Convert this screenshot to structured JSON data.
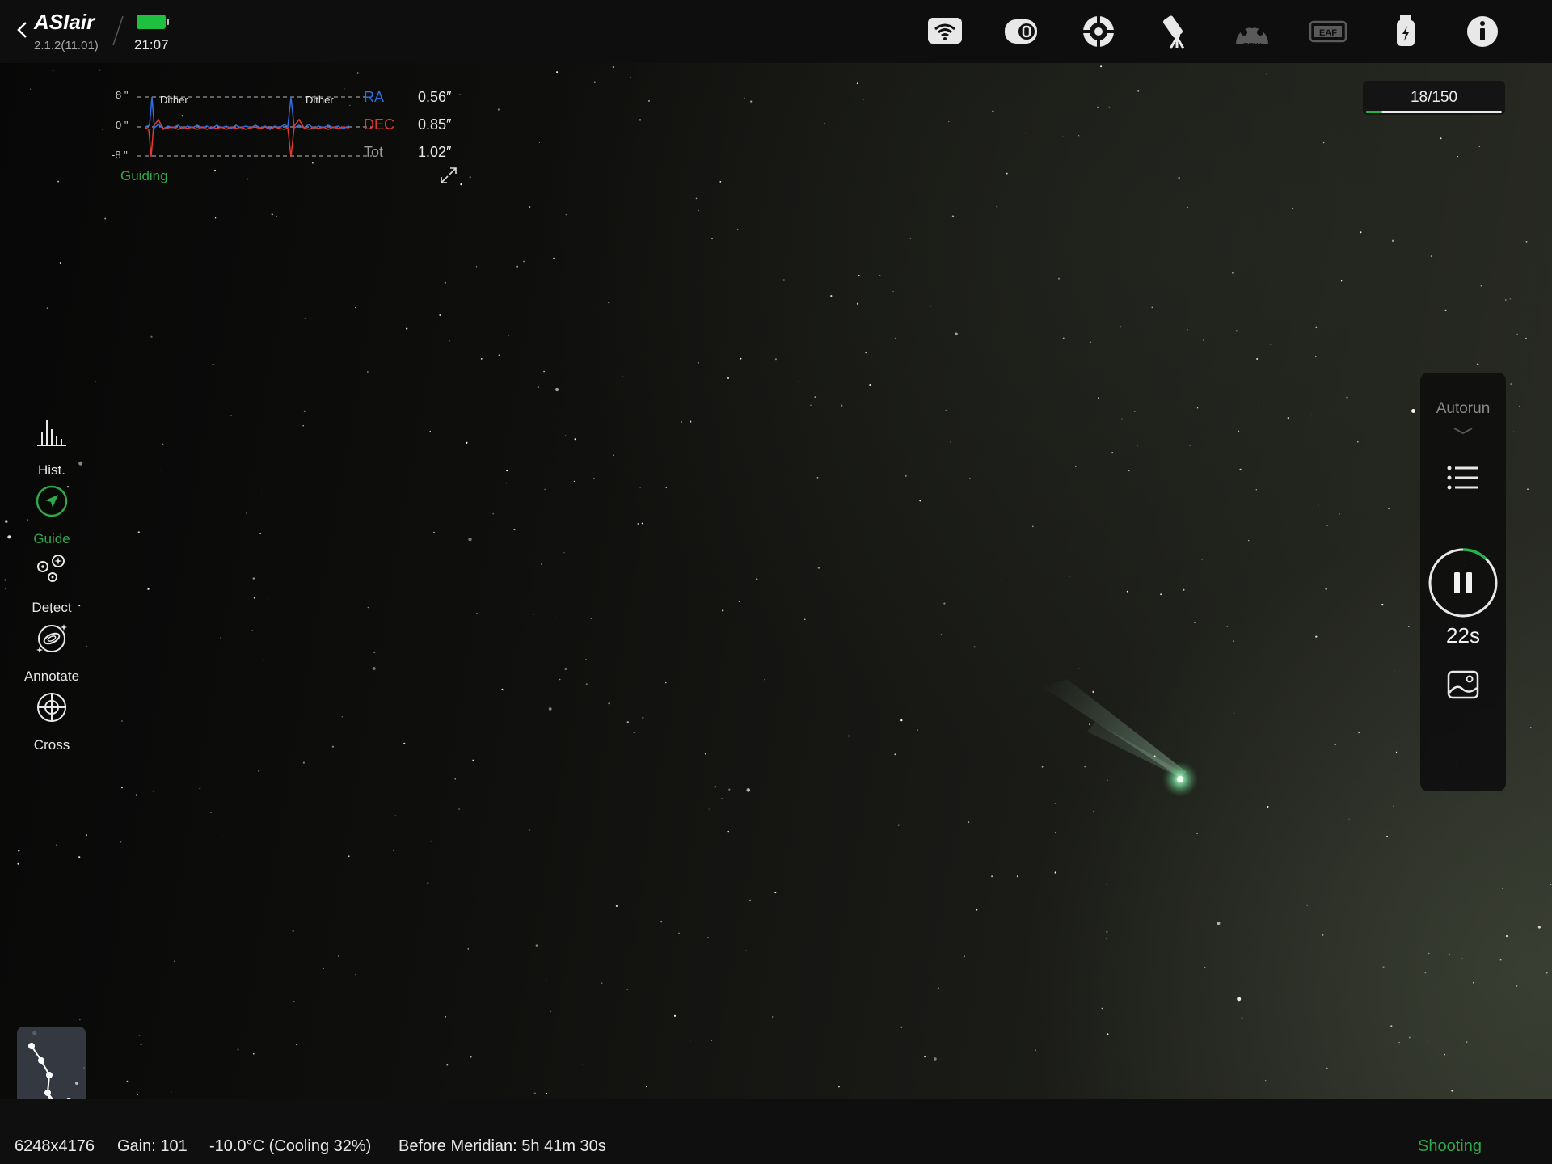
{
  "app": {
    "logo": "ASIair",
    "version": "2.1.2(11.01)",
    "clock": "21:07"
  },
  "toolbar_icons": [
    "wifi-icon",
    "camera-icon",
    "guide-scope-icon",
    "telescope-mount-icon",
    "filter-wheel-icon",
    "focuser-icon",
    "usb-storage-icon",
    "info-icon"
  ],
  "toolbar_labels": {
    "efw": "EFW",
    "eaf": "EAF"
  },
  "guide_panel": {
    "ticks": [
      "8 \"",
      "0 \"",
      "-8 \""
    ],
    "annotations": [
      "Dither",
      "Dither"
    ],
    "rows": [
      {
        "label": "RA",
        "value": "0.56″",
        "color": "#2f6fe0"
      },
      {
        "label": "DEC",
        "value": "0.85″",
        "color": "#e03a2f"
      },
      {
        "label": "Tot",
        "value": "1.02″",
        "color": "#9a9a9a"
      }
    ],
    "status": "Guiding"
  },
  "progress": {
    "label": "18/150",
    "fraction": 0.12
  },
  "left_tools": [
    {
      "label": "Hist.",
      "icon": "histogram-icon",
      "active": false
    },
    {
      "label": "Guide",
      "icon": "guide-icon",
      "active": true
    },
    {
      "label": "Detect",
      "icon": "detect-icon",
      "active": false
    },
    {
      "label": "Annotate",
      "icon": "galaxy-icon",
      "active": false
    },
    {
      "label": "Cross",
      "icon": "crosshair-icon",
      "active": false
    }
  ],
  "right_panel": {
    "title": "Autorun",
    "countdown": "22s",
    "exposure_progress": 0.12
  },
  "bottom_bar": {
    "resolution": "6248x4176",
    "gain": "Gain: 101",
    "temperature": "-10.0°C (Cooling 32%)",
    "meridian": "Before Meridian: 5h 41m 30s",
    "status": "Shooting"
  },
  "colors": {
    "accent_green": "#2fa84a",
    "ra": "#2f6fe0",
    "dec": "#e03a2f"
  }
}
